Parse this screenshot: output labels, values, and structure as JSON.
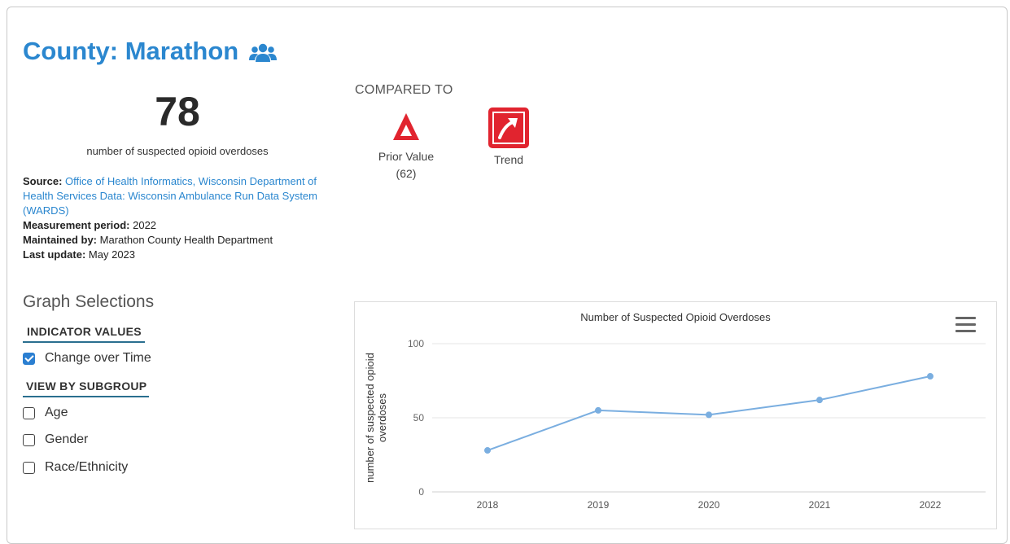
{
  "header": {
    "title": "County: Marathon",
    "icon": "people-group-icon"
  },
  "indicator": {
    "value": "78",
    "label": "number of suspected opioid overdoses"
  },
  "meta": {
    "source_label": "Source:",
    "source_text": "Office of Health Informatics, Wisconsin Department of Health Services Data: Wisconsin Ambulance Run Data System (WARDS)",
    "period_label": "Measurement period:",
    "period_value": "2022",
    "maintained_label": "Maintained by:",
    "maintained_value": "Marathon County Health Department",
    "update_label": "Last update:",
    "update_value": "May 2023"
  },
  "comparison": {
    "heading": "COMPARED TO",
    "items": [
      {
        "label": "Prior Value",
        "sub": "(62)",
        "icon": "red-triangle-up-icon",
        "color": "#e1242f"
      },
      {
        "label": "Trend",
        "sub": "",
        "icon": "trend-up-arrow-icon",
        "color": "#e1242f"
      }
    ]
  },
  "graph_selections": {
    "title": "Graph Selections",
    "indicator_values_heading": "INDICATOR VALUES",
    "change_over_time": {
      "label": "Change over Time",
      "checked": true
    },
    "subgroup_heading": "VIEW BY SUBGROUP",
    "subgroups": [
      {
        "label": "Age",
        "checked": false
      },
      {
        "label": "Gender",
        "checked": false
      },
      {
        "label": "Race/Ethnicity",
        "checked": false
      }
    ]
  },
  "colors": {
    "accent": "#2b87cf",
    "line": "#7aaee0",
    "alert": "#e1242f"
  },
  "chart_data": {
    "type": "line",
    "title": "Number of Suspected Opioid Overdoses",
    "ylabel": "number of suspected opioid overdoses",
    "xlabel": "",
    "categories": [
      "2018",
      "2019",
      "2020",
      "2021",
      "2022"
    ],
    "values": [
      28,
      55,
      52,
      62,
      78
    ],
    "ylim": [
      0,
      100
    ],
    "yticks": [
      0,
      50,
      100
    ],
    "grid": true
  }
}
